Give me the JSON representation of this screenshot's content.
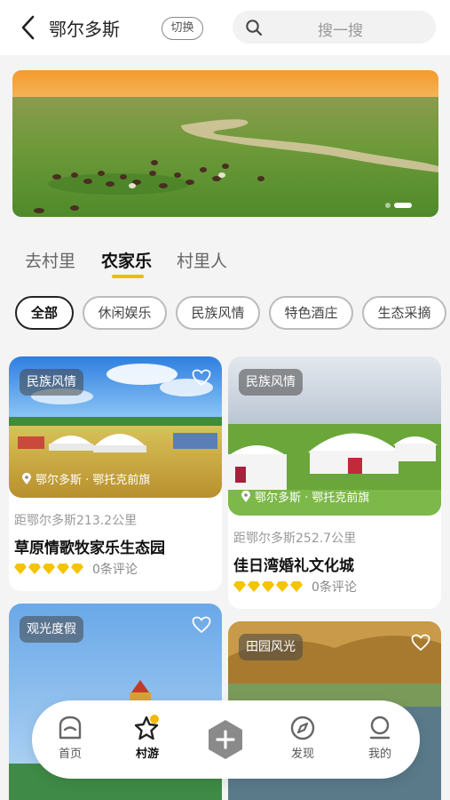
{
  "header": {
    "city": "鄂尔多斯",
    "switch_label": "切换",
    "search_placeholder": "搜一搜"
  },
  "banner": {
    "slides": 2,
    "active_slide": 2
  },
  "tabs": [
    {
      "label": "去村里",
      "active": false
    },
    {
      "label": "农家乐",
      "active": true
    },
    {
      "label": "村里人",
      "active": false
    }
  ],
  "filters": [
    {
      "label": "全部",
      "active": true
    },
    {
      "label": "休闲娱乐",
      "active": false
    },
    {
      "label": "民族风情",
      "active": false
    },
    {
      "label": "特色酒庄",
      "active": false
    },
    {
      "label": "生态采摘",
      "active": false
    }
  ],
  "cards": [
    {
      "badge": "民族风情",
      "location": "鄂尔多斯 · 鄂托克前旗",
      "distance": "距鄂尔多斯213.2公里",
      "name": "草原情歌牧家乐生态园",
      "rating": 5,
      "reviews": "0条评论"
    },
    {
      "badge": "民族风情",
      "location": "鄂尔多斯 · 鄂托克前旗",
      "distance": "距鄂尔多斯252.7公里",
      "name": "佳日湾婚礼文化城",
      "rating": 5,
      "reviews": "0条评论"
    },
    {
      "badge": "观光度假"
    },
    {
      "badge": "田园风光"
    }
  ],
  "bottom_nav": [
    {
      "label": "首页",
      "icon": "home-icon",
      "active": false
    },
    {
      "label": "村游",
      "icon": "star-icon",
      "active": true
    },
    {
      "label": "",
      "icon": "plus-icon",
      "active": false
    },
    {
      "label": "发现",
      "icon": "compass-icon",
      "active": false
    },
    {
      "label": "我的",
      "icon": "profile-icon",
      "active": false
    }
  ],
  "colors": {
    "accent": "#f5b800",
    "badge_bg": "rgba(70,70,70,0.55)",
    "gem": "#f5c400"
  }
}
